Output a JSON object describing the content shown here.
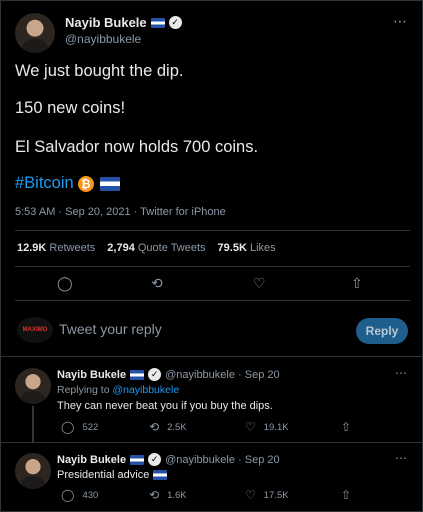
{
  "main_tweet": {
    "author_name": "Nayib Bukele",
    "author_handle": "@nayibbukele",
    "lines": [
      "We just bought the dip.",
      "150 new coins!",
      "El Salvador now holds 700 coins."
    ],
    "hashtag": "#Bitcoin",
    "meta": "5:53 AM · Sep 20, 2021 · Twitter for iPhone",
    "stats": {
      "retweets_count": "12.9K",
      "retweets_label": "Retweets",
      "quotes_count": "2,794",
      "quotes_label": "Quote Tweets",
      "likes_count": "79.5K",
      "likes_label": "Likes"
    }
  },
  "reply_box": {
    "avatar_text": "MAXIMO",
    "placeholder": "Tweet your reply",
    "button_label": "Reply"
  },
  "replies": [
    {
      "name": "Nayib Bukele",
      "handle_date": "@nayibbukele · Sep 20",
      "replying_prefix": "Replying to",
      "replying_handle": "@nayibbukele",
      "text": "They can never beat you if you buy the dips.",
      "reply_count": "522",
      "retweet_count": "2.5K",
      "like_count": "19.1K"
    },
    {
      "name": "Nayib Bukele",
      "handle_date": "@nayibbukele · Sep 20",
      "text": "Presidential advice",
      "reply_count": "430",
      "retweet_count": "1.6K",
      "like_count": "17.5K"
    }
  ],
  "icons": {
    "more": "⋯",
    "reply": "💬",
    "retweet": "⟲",
    "like": "♡",
    "share": "⇧",
    "verified": "✓",
    "bitcoin": "₿"
  },
  "colors": {
    "background": "#000000",
    "accent": "#1d9bf0",
    "bitcoin": "#f7931a",
    "muted": "#8b98a5"
  }
}
